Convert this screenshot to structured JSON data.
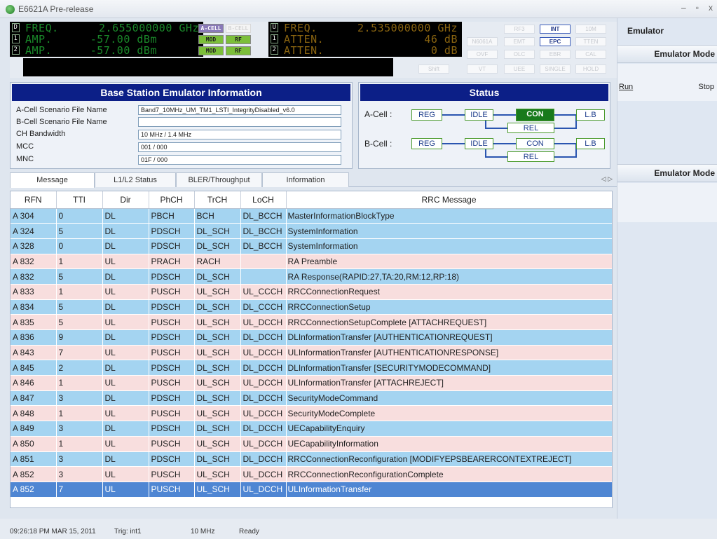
{
  "window": {
    "title": "E6621A Pre-release",
    "min": "–",
    "max": "▫",
    "close": "x"
  },
  "lcd_left": {
    "rows": [
      {
        "box": "D",
        "label": "FREQ.",
        "value": "2.655000000 GHz"
      },
      {
        "box": "1",
        "label": "AMP.",
        "value": "-57.00 dBm"
      },
      {
        "box": "2",
        "label": "AMP.",
        "value": "-57.00 dBm"
      }
    ],
    "chips": [
      "A-CELL",
      "B-CELL",
      "MOD",
      "RF",
      "MOD",
      "RF"
    ]
  },
  "lcd_right": {
    "rows": [
      {
        "box": "U",
        "label": "FREQ.",
        "value": "2.535000000 GHz"
      },
      {
        "box": "1",
        "label": "ATTEN.",
        "value": "46 dB"
      },
      {
        "box": "2",
        "label": "ATTEN.",
        "value": "0 dB"
      }
    ]
  },
  "softkeys": [
    "N6061A",
    "OVF",
    "Shift",
    "RF3",
    "EMT",
    "OLC",
    "VT",
    "UEE",
    "INT",
    "EPC",
    "EBR",
    "SINGLE",
    "10M",
    "TTEN",
    "CAL",
    "HOLD"
  ],
  "emulator": {
    "title": "Emulator",
    "mode_heading": "Emulator Mode",
    "run": "Run",
    "stop": "Stop",
    "mode_heading_2": "Emulator Mode"
  },
  "info": {
    "title": "Base Station Emulator Information",
    "rows": [
      {
        "label": "A-Cell Scenario File Name",
        "value": "Band7_10MHz_UM_TM1_LSTI_IntegrityDisabled_v6.0"
      },
      {
        "label": "B-Cell Scenario File Name",
        "value": ""
      },
      {
        "label": "CH Bandwidth",
        "value": "10 MHz / 1.4 MHz"
      },
      {
        "label": "MCC",
        "value": "001 / 000"
      },
      {
        "label": "MNC",
        "value": "01F / 000"
      }
    ]
  },
  "status": {
    "title": "Status",
    "a_cell": "A-Cell :",
    "b_cell": "B-Cell :",
    "states": [
      "REG",
      "IDLE",
      "CON",
      "L.B",
      "REL"
    ]
  },
  "tabs": [
    "Message",
    "L1/L2 Status",
    "BLER/Throughput",
    "Information"
  ],
  "tab_arrows": "◁ ▷",
  "table": {
    "columns": [
      "RFN",
      "TTI",
      "Dir",
      "PhCH",
      "TrCH",
      "LoCH",
      "RRC Message"
    ],
    "rows": [
      [
        "A 304",
        "0",
        "DL",
        "PBCH",
        "BCH",
        "DL_BCCH",
        "MasterInformationBlockType"
      ],
      [
        "A 324",
        "5",
        "DL",
        "PDSCH",
        "DL_SCH",
        "DL_BCCH",
        "SystemInformation"
      ],
      [
        "A 328",
        "0",
        "DL",
        "PDSCH",
        "DL_SCH",
        "DL_BCCH",
        "SystemInformation"
      ],
      [
        "A 832",
        "1",
        "UL",
        "PRACH",
        "RACH",
        "",
        "RA Preamble"
      ],
      [
        "A 832",
        "5",
        "DL",
        "PDSCH",
        "DL_SCH",
        "",
        "RA Response(RAPID:27,TA:20,RM:12,RP:18)"
      ],
      [
        "A 833",
        "1",
        "UL",
        "PUSCH",
        "UL_SCH",
        "UL_CCCH",
        "RRCConnectionRequest"
      ],
      [
        "A 834",
        "5",
        "DL",
        "PDSCH",
        "DL_SCH",
        "DL_CCCH",
        "RRCConnectionSetup"
      ],
      [
        "A 835",
        "5",
        "UL",
        "PUSCH",
        "UL_SCH",
        "UL_DCCH",
        "RRCConnectionSetupComplete [ATTACHREQUEST]"
      ],
      [
        "A 836",
        "9",
        "DL",
        "PDSCH",
        "DL_SCH",
        "DL_DCCH",
        "DLInformationTransfer [AUTHENTICATIONREQUEST]"
      ],
      [
        "A 843",
        "7",
        "UL",
        "PUSCH",
        "UL_SCH",
        "UL_DCCH",
        "ULInformationTransfer [AUTHENTICATIONRESPONSE]"
      ],
      [
        "A 845",
        "2",
        "DL",
        "PDSCH",
        "DL_SCH",
        "DL_DCCH",
        "DLInformationTransfer [SECURITYMODECOMMAND]"
      ],
      [
        "A 846",
        "1",
        "UL",
        "PUSCH",
        "UL_SCH",
        "UL_DCCH",
        "ULInformationTransfer [ATTACHREJECT]"
      ],
      [
        "A 847",
        "3",
        "DL",
        "PDSCH",
        "DL_SCH",
        "DL_DCCH",
        "SecurityModeCommand"
      ],
      [
        "A 848",
        "1",
        "UL",
        "PUSCH",
        "UL_SCH",
        "UL_DCCH",
        "SecurityModeComplete"
      ],
      [
        "A 849",
        "3",
        "DL",
        "PDSCH",
        "DL_SCH",
        "DL_DCCH",
        "UECapabilityEnquiry"
      ],
      [
        "A 850",
        "1",
        "UL",
        "PUSCH",
        "UL_SCH",
        "UL_DCCH",
        "UECapabilityInformation"
      ],
      [
        "A 851",
        "3",
        "DL",
        "PDSCH",
        "DL_SCH",
        "DL_DCCH",
        "RRCConnectionReconfiguration [MODIFYEPSBEARERCONTEXTREJECT]"
      ],
      [
        "A 852",
        "3",
        "UL",
        "PUSCH",
        "UL_SCH",
        "UL_DCCH",
        "RRCConnectionReconfigurationComplete"
      ],
      [
        "A 852",
        "7",
        "UL",
        "PUSCH",
        "UL_SCH",
        "UL_DCCH",
        "ULInformationTransfer"
      ]
    ],
    "selected_row": 18
  },
  "statusbar": {
    "time": "09:26:18 PM MAR 15, 2011",
    "trig": "Trig: int1",
    "bw": "10 MHz",
    "state": "Ready"
  }
}
